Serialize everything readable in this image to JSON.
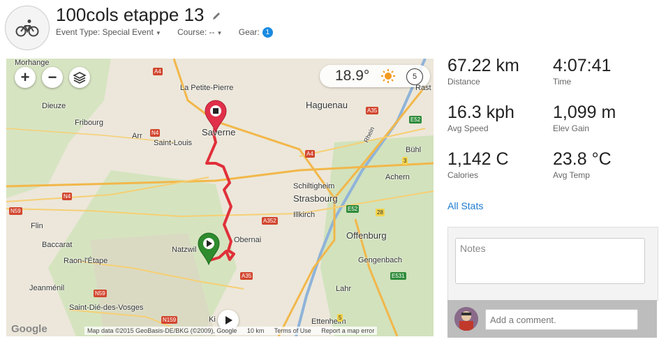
{
  "header": {
    "title": "100cols etappe 13",
    "event_type": "Event Type: Special Event",
    "course": "Course: --",
    "gear_label": "Gear:",
    "gear_count": "1"
  },
  "map": {
    "weather": {
      "temp": "18.9°",
      "wind": "5",
      "icon": "sun-icon"
    },
    "controls": {
      "zoom_in": "+",
      "zoom_out": "−"
    },
    "labels": {
      "morhange": "Morhange",
      "dieuze": "Dieuze",
      "fribourg": "Fribourg",
      "arr": "Arr",
      "saint_louis": "Saint-Louis",
      "la_petite_pierre": "La Petite-Pierre",
      "saverne": "Saverne",
      "haguenau": "Haguenau",
      "rast": "Rast",
      "buhl": "Bühl",
      "achern": "Achern",
      "schiltigheim": "Schiltigheim",
      "strasbourg": "Strasbourg",
      "illkirch": "Illkirch",
      "offenburg": "Offenburg",
      "obernai": "Obernai",
      "natzwiller": "Natzwil",
      "flin": "Flin",
      "baccarat": "Baccarat",
      "raon": "Raon-l'Étape",
      "jeanmenil": "Jeanménil",
      "saint_die": "Saint-Dié-des-Vosges",
      "gengenbach": "Gengenbach",
      "lahr": "Lahr",
      "ettenheim": "Ettenheim",
      "rhein": "Rhein",
      "kin": "Ki"
    },
    "shields": {
      "a4_top": "A4",
      "a4_mid": "A4",
      "n4": "N4",
      "n4_left": "N4",
      "n59": "N59",
      "n59b": "N59",
      "a35_top": "A35",
      "a35_bot": "A35",
      "a352": "A352",
      "e52": "E52",
      "e52b": "E52",
      "n159": "N159",
      "e531": "E531",
      "n3": "3",
      "n28": "28",
      "n5": "5"
    },
    "attribution": {
      "google": "Google",
      "data": "Map data ©2015 GeoBasis-DE/BKG (©2009), Google",
      "scale": "10 km",
      "terms": "Terms of Use",
      "report": "Report a map error"
    }
  },
  "stats": {
    "distance": {
      "value": "67.22 km",
      "label": "Distance"
    },
    "time": {
      "value": "4:07:41",
      "label": "Time"
    },
    "avg_speed": {
      "value": "16.3 kph",
      "label": "Avg Speed"
    },
    "elev_gain": {
      "value": "1,099 m",
      "label": "Elev Gain"
    },
    "calories": {
      "value": "1,142 C",
      "label": "Calories"
    },
    "avg_temp": {
      "value": "23.8 °C",
      "label": "Avg Temp"
    }
  },
  "all_stats": "All Stats",
  "notes": {
    "placeholder": "Notes"
  },
  "comment": {
    "placeholder": "Add a comment."
  },
  "colors": {
    "route": "#e0303a",
    "start": "#2e8b2e",
    "end": "#e0304a",
    "link": "#1a7ad1"
  }
}
